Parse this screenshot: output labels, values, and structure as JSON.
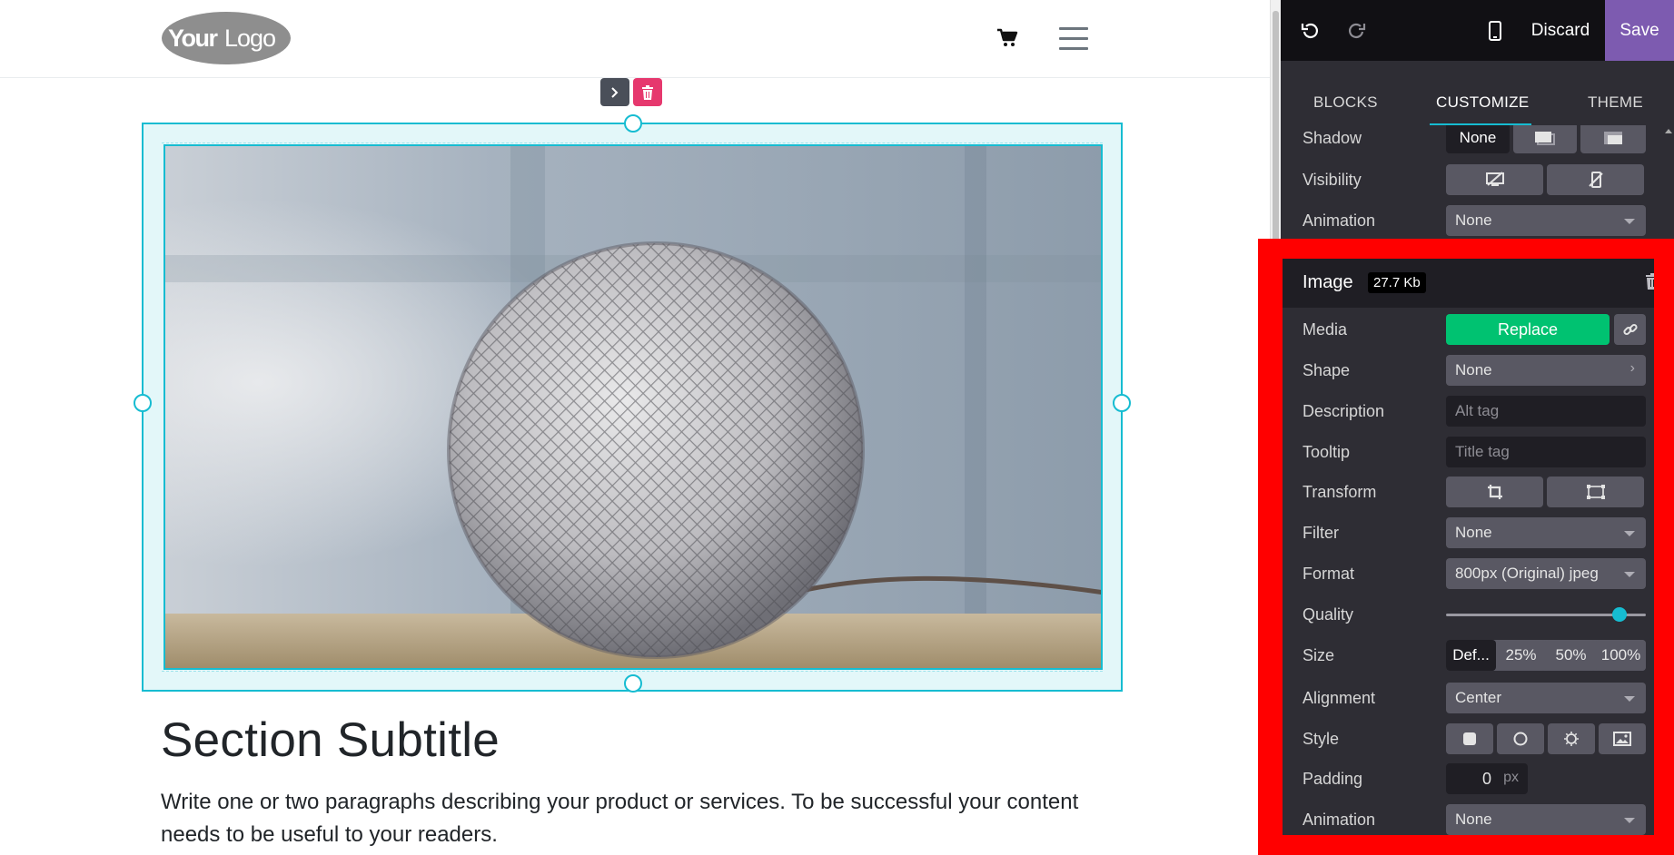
{
  "site": {
    "logo_text": "YourLogo",
    "section_title": "Section Subtitle",
    "section_text": "Write one or two paragraphs describing your product or services. To be successful your content needs to be useful to your readers."
  },
  "editor": {
    "topbar": {
      "discard_label": "Discard",
      "save_label": "Save"
    },
    "tabs": [
      {
        "label": "BLOCKS"
      },
      {
        "label": "CUSTOMIZE"
      },
      {
        "label": "THEME"
      }
    ],
    "top_rows": {
      "shadow": {
        "label": "Shadow",
        "value": "None"
      },
      "visibility": {
        "label": "Visibility"
      },
      "animation": {
        "label": "Animation",
        "value": "None"
      }
    },
    "image_panel": {
      "title": "Image",
      "size_badge": "27.7 Kb",
      "media": {
        "label": "Media",
        "button": "Replace"
      },
      "shape": {
        "label": "Shape",
        "value": "None"
      },
      "description": {
        "label": "Description",
        "placeholder": "Alt tag"
      },
      "tooltip": {
        "label": "Tooltip",
        "placeholder": "Title tag"
      },
      "transform": {
        "label": "Transform"
      },
      "filter": {
        "label": "Filter",
        "value": "None"
      },
      "format": {
        "label": "Format",
        "value": "800px (Original) jpeg"
      },
      "quality": {
        "label": "Quality",
        "level": 0.87
      },
      "size": {
        "label": "Size",
        "options": [
          "Def...",
          "25%",
          "50%",
          "100%"
        ]
      },
      "alignment": {
        "label": "Alignment",
        "value": "Center"
      },
      "style": {
        "label": "Style"
      },
      "padding": {
        "label": "Padding",
        "value": "0",
        "unit": "px"
      },
      "animation": {
        "label": "Animation",
        "value": "None"
      }
    }
  },
  "colors": {
    "accent": "#16bcd1",
    "save": "#7d5bb0",
    "replace": "#00c271",
    "highlight": "#ff0000"
  }
}
